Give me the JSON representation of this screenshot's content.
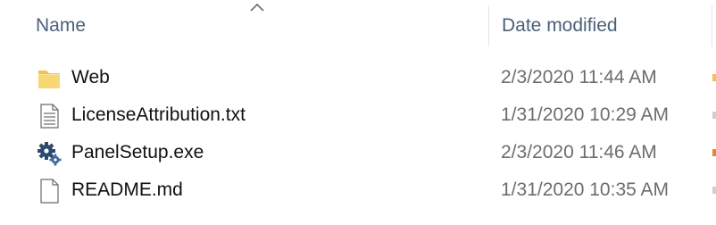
{
  "columns": {
    "name_label": "Name",
    "date_label": "Date modified",
    "sort_direction": "ascending"
  },
  "files": [
    {
      "name": "Web",
      "date": "2/3/2020 11:44 AM",
      "icon": "folder-icon"
    },
    {
      "name": "LicenseAttribution.txt",
      "date": "1/31/2020 10:29 AM",
      "icon": "text-file-icon"
    },
    {
      "name": "PanelSetup.exe",
      "date": "2/3/2020 11:46 AM",
      "icon": "executable-gear-icon"
    },
    {
      "name": "README.md",
      "date": "1/31/2020 10:35 AM",
      "icon": "blank-file-icon"
    }
  ],
  "colors": {
    "header_text": "#4c607a",
    "date_text": "#6d6d6d",
    "folder_yellow": "#f8d775",
    "gear_blue": "#2c4a6e"
  }
}
